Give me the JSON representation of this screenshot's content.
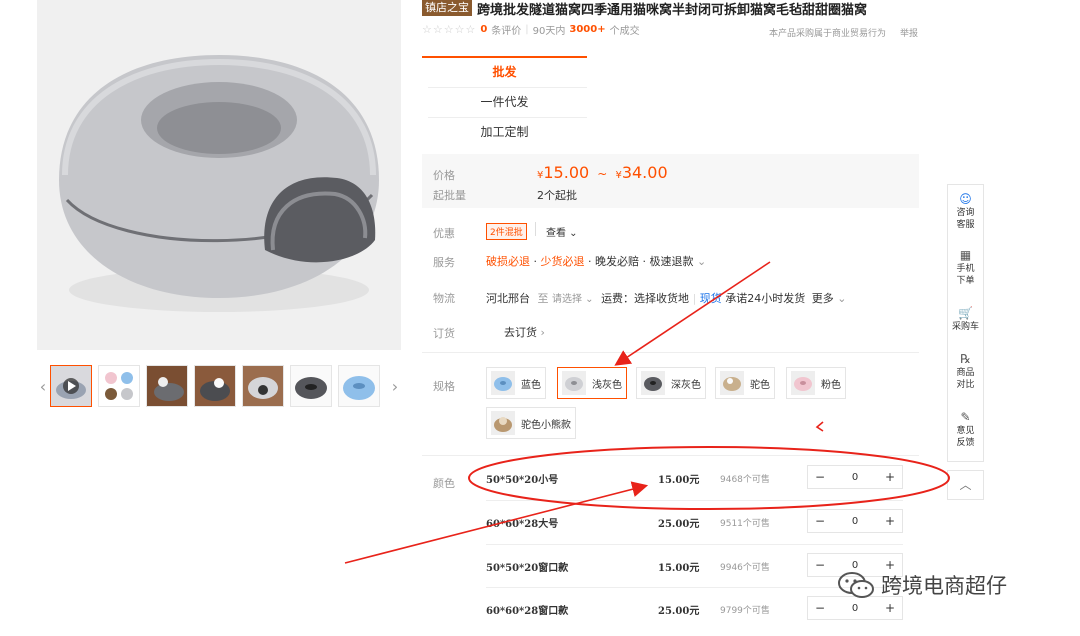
{
  "header": {
    "shop_tag": "镇店之宝",
    "title": "跨境批发隧道猫窝四季通用猫咪窝半封闭可拆卸猫窝毛毡甜甜圈猫窝",
    "rating_stars": "☆☆☆☆☆",
    "review_count": "0",
    "review_label": "条评价",
    "sales_prefix": "90天内",
    "sales_count": "3000+",
    "sales_suffix": "个成交",
    "trade_notice": "本产品采购属于商业贸易行为",
    "report_link": "举报"
  },
  "tabs": [
    {
      "label": "批发",
      "active": true
    },
    {
      "label": "一件代发",
      "active": false
    },
    {
      "label": "加工定制",
      "active": false
    }
  ],
  "price": {
    "label": "价格",
    "currency": "¥",
    "low": "15.00",
    "tilde": "~",
    "high": "34.00",
    "moq_label": "起批量",
    "moq_value": "2个起批"
  },
  "promo": {
    "label": "优惠",
    "tag": "2件混批",
    "view": "查看"
  },
  "service": {
    "label": "服务",
    "items": [
      "破损必退",
      "少货必退",
      "晚发必赔",
      "极速退款"
    ],
    "dot": "·"
  },
  "logistics": {
    "label": "物流",
    "origin": "河北邢台",
    "to": "至",
    "select": "请选择",
    "fee": "运费：选择收货地",
    "stock_tag": "现货",
    "promise": "承诺24小时发货",
    "more": "更多"
  },
  "order": {
    "label": "订货",
    "link": "去订货"
  },
  "spec": {
    "label": "规格",
    "options": [
      {
        "label": "蓝色",
        "active": false,
        "swatch": "#8fbfea"
      },
      {
        "label": "浅灰色",
        "active": true,
        "swatch": "#cfd0d4"
      },
      {
        "label": "深灰色",
        "active": false,
        "swatch": "#5a5b60"
      },
      {
        "label": "驼色",
        "active": false,
        "swatch": "#c9b08d"
      },
      {
        "label": "粉色",
        "active": false,
        "swatch": "#f1c5cf"
      },
      {
        "label": "驼色小熊款",
        "active": false,
        "swatch": "#b99870"
      }
    ]
  },
  "color_label": "颜色",
  "sizes": [
    {
      "name": "50*50*20小号",
      "price": "15.00元",
      "stock": "9468个可售",
      "qty": "0"
    },
    {
      "name": "60*60*28大号",
      "price": "25.00元",
      "stock": "9511个可售",
      "qty": "0"
    },
    {
      "name": "50*50*20窗口款",
      "price": "15.00元",
      "stock": "9946个可售",
      "qty": "0"
    },
    {
      "name": "60*60*28窗口款",
      "price": "25.00元",
      "stock": "9799个可售",
      "qty": "0"
    }
  ],
  "stepper": {
    "minus": "−",
    "plus": "+"
  },
  "sidebar": [
    {
      "icon": "☺",
      "label1": "咨询",
      "label2": "客服"
    },
    {
      "icon": "▦",
      "label1": "手机",
      "label2": "下单"
    },
    {
      "icon": "🛒",
      "label1": "采购车",
      "label2": ""
    },
    {
      "icon": "℞",
      "label1": "商品",
      "label2": "对比"
    },
    {
      "icon": "✎",
      "label1": "意见",
      "label2": "反馈"
    }
  ],
  "back_top": "︿",
  "watermark": "跨境电商超仔",
  "thumb_arrows": {
    "left": "‹",
    "right": "›"
  },
  "colors": {
    "accent": "#ff5000",
    "annotation_red": "#e8231a",
    "link_blue": "#1a72e8"
  }
}
